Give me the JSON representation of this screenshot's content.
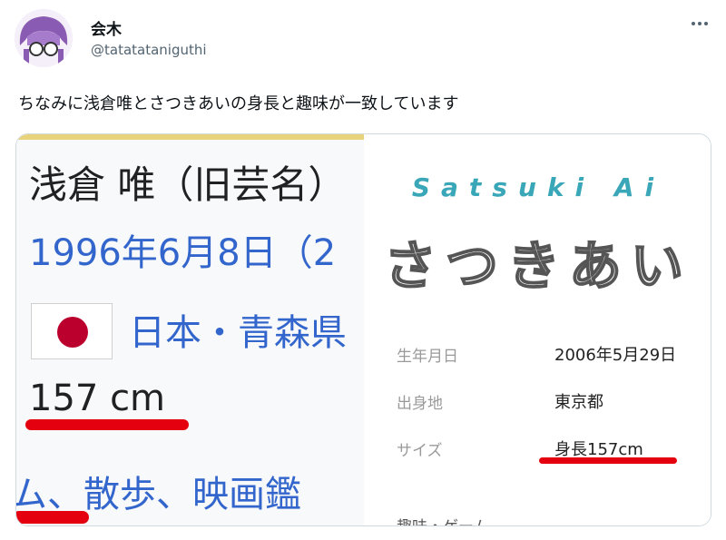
{
  "post": {
    "author_name": "会木",
    "author_handle": "@tatatataniguthi",
    "text": "ちなみに浅倉唯とさつきあいの身長と趣味が一致しています",
    "more_icon": "more-horizontal-icon"
  },
  "left_panel": {
    "title": "浅倉 唯（旧芸名）",
    "birth": "1996年6月8日（2",
    "place": "日本・青森県",
    "height": "157 cm",
    "hobby": "ム、散歩、映画鑑",
    "flag_icon": "japan-flag-icon"
  },
  "right_panel": {
    "name_en": "Satsuki Ai",
    "name_jp": "さつきあい",
    "rows": [
      {
        "label": "生年月日",
        "value": "2006年5月29日"
      },
      {
        "label": "出身地",
        "value": "東京都"
      },
      {
        "label": "サイズ",
        "value": "身長157cm"
      }
    ],
    "cut_row": "趣味・ゲーム"
  },
  "colors": {
    "link": "#3366cc",
    "highlight": "#e5000f",
    "accent": "#3aa7b8"
  }
}
